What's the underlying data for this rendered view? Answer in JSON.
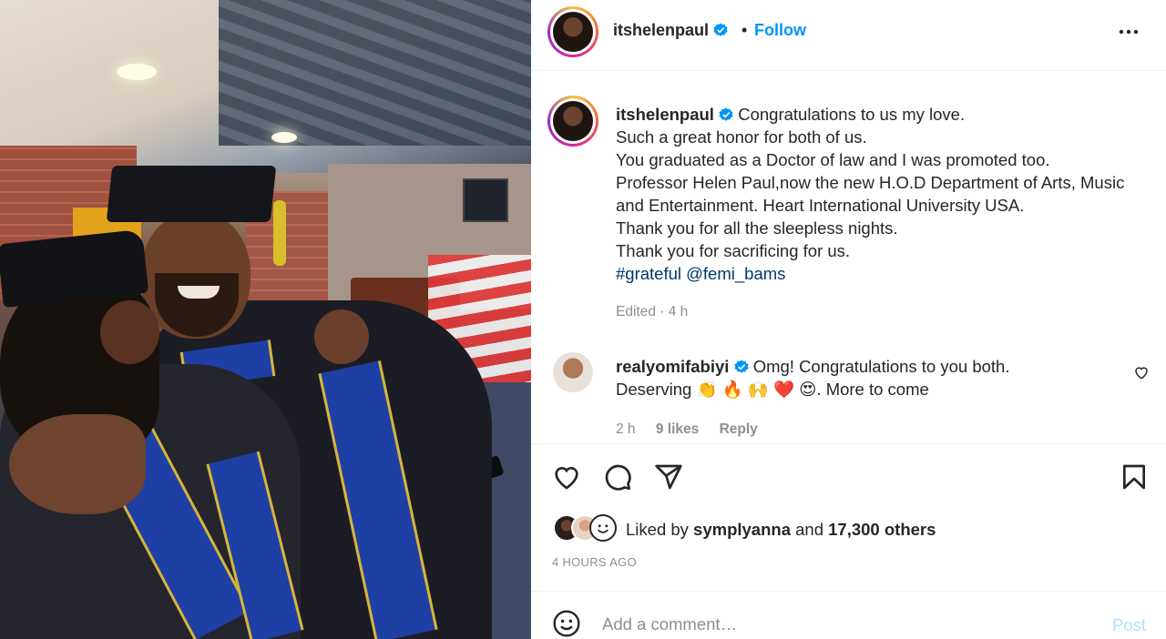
{
  "colors": {
    "accent": "#0095f6",
    "link": "#00376b",
    "muted": "#8e8e8e",
    "text": "#262626",
    "post_disabled": "#b2dffc"
  },
  "header": {
    "username": "itshelenpaul",
    "separator": "•",
    "follow_label": "Follow",
    "more_label": "•••"
  },
  "caption": {
    "username": "itshelenpaul",
    "lines": [
      "Congratulations to us my love.",
      "Such a great honor for both of us.",
      "You graduated as a Doctor of law and I was promoted too.",
      "Professor Helen Paul,now the new H.O.D Department of Arts, Music",
      "and Entertainment. Heart International University USA.",
      "Thank you for all the sleepless nights.",
      "Thank you for sacrificing for us."
    ],
    "hashtag": "#grateful",
    "mention": "@femi_bams",
    "edited": "Edited · 4 h"
  },
  "comment": {
    "username": "realyomifabiyi",
    "text_line1": "Omg! Congratulations to you both.",
    "text_line2_prefix": "Deserving ",
    "emojis": "👏 🔥 🙌 ❤️ 😍",
    "text_line2_suffix": ". More to come",
    "time": "2 h",
    "likes": "9 likes",
    "reply_label": "Reply"
  },
  "likes": {
    "prefix": "Liked by ",
    "first_user": "symplyanna",
    "joiner": " and ",
    "others": "17,300 others"
  },
  "timestamp": "4 HOURS AGO",
  "add_comment": {
    "placeholder": "Add a comment…",
    "post_label": "Post"
  },
  "icons": {
    "header_avatar": "profile-avatar",
    "verified": "verified-badge-icon",
    "like": "heart-icon",
    "comment": "comment-bubble-icon",
    "share": "paper-plane-icon",
    "save": "bookmark-icon",
    "emoji": "smiley-face-icon"
  }
}
